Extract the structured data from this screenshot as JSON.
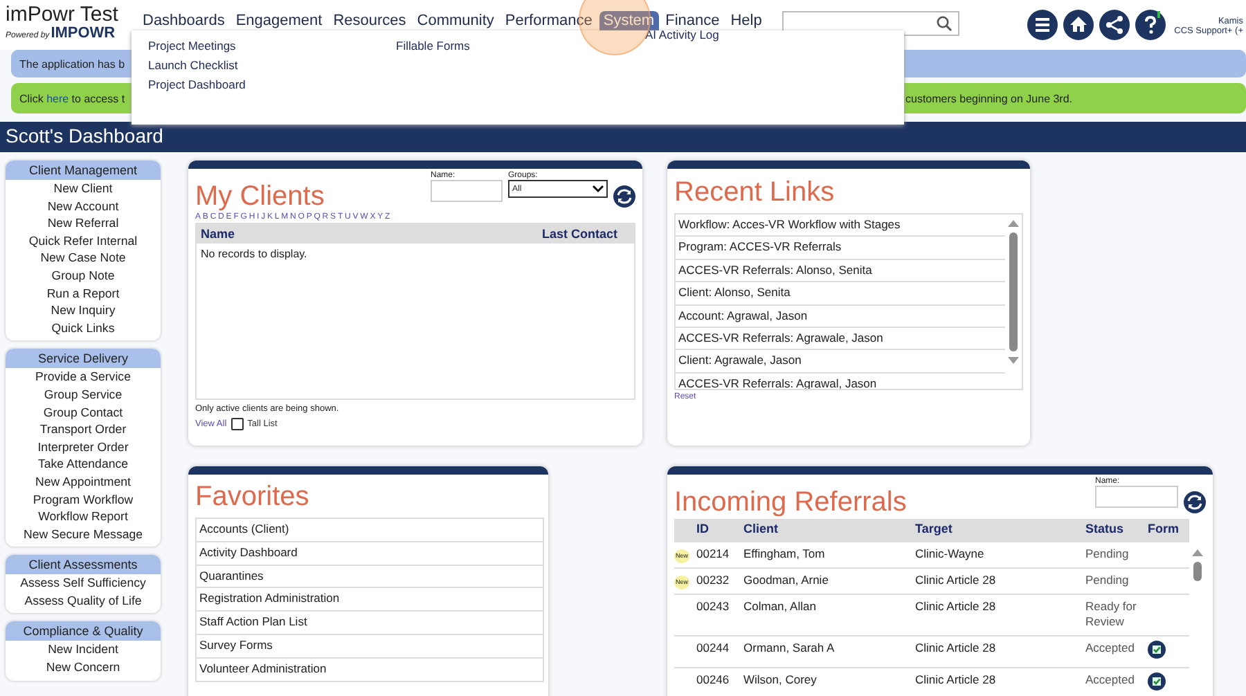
{
  "header": {
    "logo_title": "imPowr Test",
    "logo_sub_prefix": "Powered by",
    "logo_sub_brand": "IMPOWR",
    "nav": [
      {
        "label": "Dashboards",
        "selected": false
      },
      {
        "label": "Engagement",
        "selected": false
      },
      {
        "label": "Resources",
        "selected": false
      },
      {
        "label": "Community",
        "selected": false
      },
      {
        "label": "Performance",
        "selected": false
      },
      {
        "label": "System",
        "selected": true
      },
      {
        "label": "Finance",
        "selected": false
      },
      {
        "label": "Help",
        "selected": false
      }
    ],
    "user": {
      "name": "Kamis",
      "role": "CCS Support+ (+"
    }
  },
  "menu": {
    "columns": [
      [
        "Project Meetings",
        "Launch Checklist",
        "Project Dashboard"
      ],
      [
        "Fillable Forms"
      ],
      [
        "AI Activity Log"
      ]
    ]
  },
  "banners": [
    {
      "kind": "info",
      "left": "The application has b"
    },
    {
      "kind": "notice",
      "link_before": "Click",
      "link": "here",
      "left": "to access t",
      "right": "customers beginning on June 3rd."
    }
  ],
  "page_title": "Scott's Dashboard",
  "sidebar": [
    {
      "title": "Client Management",
      "items": [
        "New Client",
        "New Account",
        "New Referral",
        "Quick Refer Internal",
        "New Case Note",
        "Group Note",
        "Run a Report",
        "New Inquiry",
        "Quick Links"
      ]
    },
    {
      "title": "Service Delivery",
      "items": [
        "Provide a Service",
        "Group Service",
        "Group Contact",
        "Transport Order",
        "Interpreter Order",
        "Take Attendance",
        "New Appointment",
        "Program Workflow",
        "Workflow Report",
        "New Secure Message"
      ]
    },
    {
      "title": "Client Assessments",
      "items": [
        "Assess Self Sufficiency",
        "Assess Quality of Life"
      ]
    },
    {
      "title": "Compliance & Quality",
      "items": [
        "New Incident",
        "New Concern"
      ]
    }
  ],
  "my_clients": {
    "title": "My Clients",
    "name_label": "Name:",
    "groups_label": "Groups:",
    "groups_value": "All",
    "letters": [
      "A",
      "B",
      "C",
      "D",
      "E",
      "F",
      "G",
      "H",
      "I",
      "J",
      "K",
      "L",
      "M",
      "N",
      "O",
      "P",
      "Q",
      "R",
      "S",
      "T",
      "U",
      "V",
      "W",
      "X",
      "Y",
      "Z"
    ],
    "columns": [
      "Name",
      "Last Contact"
    ],
    "empty": "No records to display.",
    "note": "Only active clients are being shown.",
    "view_all": "View All",
    "tall_list": {
      "label": "Tall List",
      "checked": false
    }
  },
  "recent_links": {
    "title": "Recent Links",
    "items": [
      "Workflow: Acces-VR Workflow with Stages",
      "Program: ACCES-VR Referrals",
      "ACCES-VR Referrals: Alonso, Senita",
      "Client: Alonso, Senita",
      "Account: Agrawal, Jason",
      "ACCES-VR Referrals: Agrawale, Jason",
      "Client: Agrawale, Jason",
      "ACCES-VR Referrals: Agrawal, Jason"
    ],
    "reset": "Reset"
  },
  "favorites": {
    "title": "Favorites",
    "items": [
      "Accounts (Client)",
      "Activity Dashboard",
      "Quarantines",
      "Registration Administration",
      "Staff Action Plan List",
      "Survey Forms",
      "Volunteer Administration"
    ]
  },
  "incoming_referrals": {
    "title": "Incoming Referrals",
    "name_label": "Name:",
    "columns": [
      "ID",
      "Client",
      "Target",
      "Status",
      "Form"
    ],
    "rows": [
      {
        "new": true,
        "new_label": "New",
        "id": "00214",
        "client": "Effingham, Tom",
        "target": "Clinic-Wayne",
        "status": "Pending",
        "form": false
      },
      {
        "new": true,
        "new_label": "New",
        "id": "00232",
        "client": "Goodman, Arnie",
        "target": "Clinic Article 28",
        "status": "Pending",
        "form": false
      },
      {
        "new": false,
        "id": "00243",
        "client": "Colman, Allan",
        "target": "Clinic Article 28",
        "status": "Ready for Review",
        "form": false
      },
      {
        "new": false,
        "id": "00244",
        "client": "Ormann, Sarah A",
        "target": "Clinic Article 28",
        "status": "Accepted",
        "form": true
      },
      {
        "new": false,
        "id": "00246",
        "client": "Wilson, Corey",
        "target": "Clinic Article 28",
        "status": "Accepted",
        "form": true
      }
    ]
  }
}
